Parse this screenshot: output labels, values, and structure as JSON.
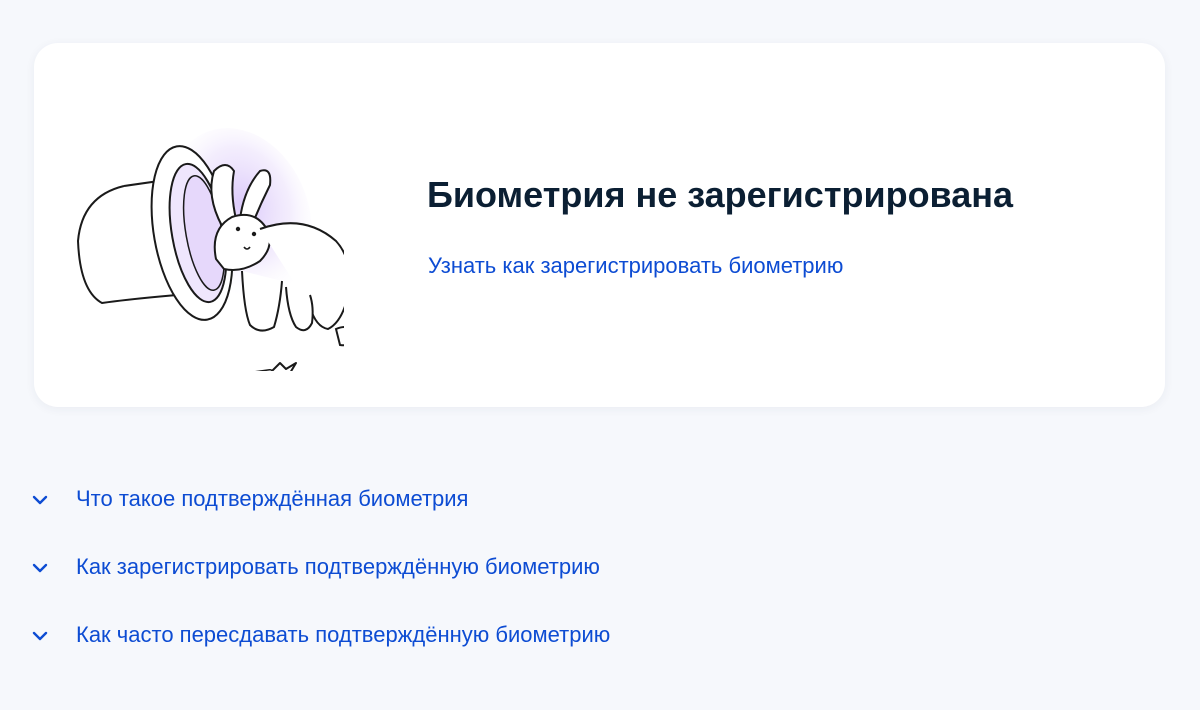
{
  "card": {
    "title": "Биометрия не зарегистрирована",
    "link": "Узнать как зарегистрировать биометрию",
    "illustration_icon": "magic-hat-rabbit-illustration"
  },
  "faq": {
    "items": [
      {
        "label": "Что такое подтверждённая биометрия",
        "icon": "chevron-down-icon"
      },
      {
        "label": "Как зарегистрировать подтверждённую биометрию",
        "icon": "chevron-down-icon"
      },
      {
        "label": "Как часто пересдавать подтверждённую биометрию",
        "icon": "chevron-down-icon"
      }
    ]
  },
  "colors": {
    "page_background": "#f6f8fc",
    "card_background": "#ffffff",
    "title": "#0b1f33",
    "link": "#0d4cd3",
    "glow": "#e4d6fb"
  }
}
